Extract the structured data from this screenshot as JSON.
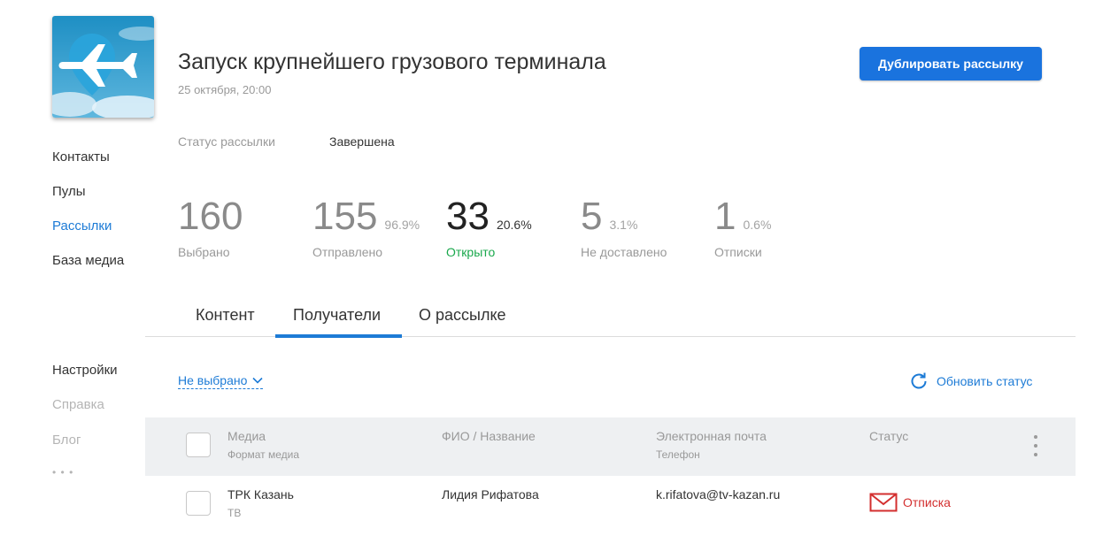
{
  "app": {
    "accent": "#1d7bd6",
    "button_color": "#1a73de",
    "success_color": "#19a84c",
    "danger_color": "#d32f2f"
  },
  "sidebar": {
    "items": [
      {
        "label": "Контакты",
        "state": "normal"
      },
      {
        "label": "Пулы",
        "state": "normal"
      },
      {
        "label": "Рассылки",
        "state": "active"
      },
      {
        "label": "База медиа",
        "state": "normal"
      },
      {
        "label": "Настройки",
        "state": "normal"
      },
      {
        "label": "Справка",
        "state": "muted"
      },
      {
        "label": "Блог",
        "state": "muted"
      },
      {
        "label": "• • •",
        "state": "muted"
      }
    ]
  },
  "header": {
    "logo_icon": "airplane-pin-icon",
    "title": "Запуск крупнейшего грузового терминала",
    "date": "25 октября, 20:00",
    "duplicate_label": "Дублировать рассылку"
  },
  "status": {
    "label": "Статус рассылки",
    "value": "Завершена"
  },
  "stats": [
    {
      "value": "160",
      "percent": "",
      "label": "Выбрано"
    },
    {
      "value": "155",
      "percent": "96.9%",
      "label": "Отправлено"
    },
    {
      "value": "33",
      "percent": "20.6%",
      "label": "Открыто"
    },
    {
      "value": "5",
      "percent": "3.1%",
      "label": "Не доставлено"
    },
    {
      "value": "1",
      "percent": "0.6%",
      "label": "Отписки"
    }
  ],
  "tabs": [
    {
      "label": "Контент"
    },
    {
      "label": "Получатели",
      "active": true
    },
    {
      "label": "О рассылке"
    }
  ],
  "filter": {
    "label": "Не выбрано",
    "icon": "chevron-down-icon"
  },
  "refresh": {
    "label": "Обновить статус",
    "icon": "refresh-icon"
  },
  "table": {
    "headers": {
      "media": "Медиа",
      "media_sub": "Формат медиа",
      "name": "ФИО / Название",
      "email": "Электронная почта",
      "email_sub": "Телефон",
      "status": "Статус"
    },
    "rows": [
      {
        "media": "ТРК Казань",
        "format": "ТВ",
        "name": "Лидия Рифатова",
        "email": "k.rifatova@tv-kazan.ru",
        "status": "Отписка",
        "status_icon": "envelope-icon"
      }
    ]
  }
}
